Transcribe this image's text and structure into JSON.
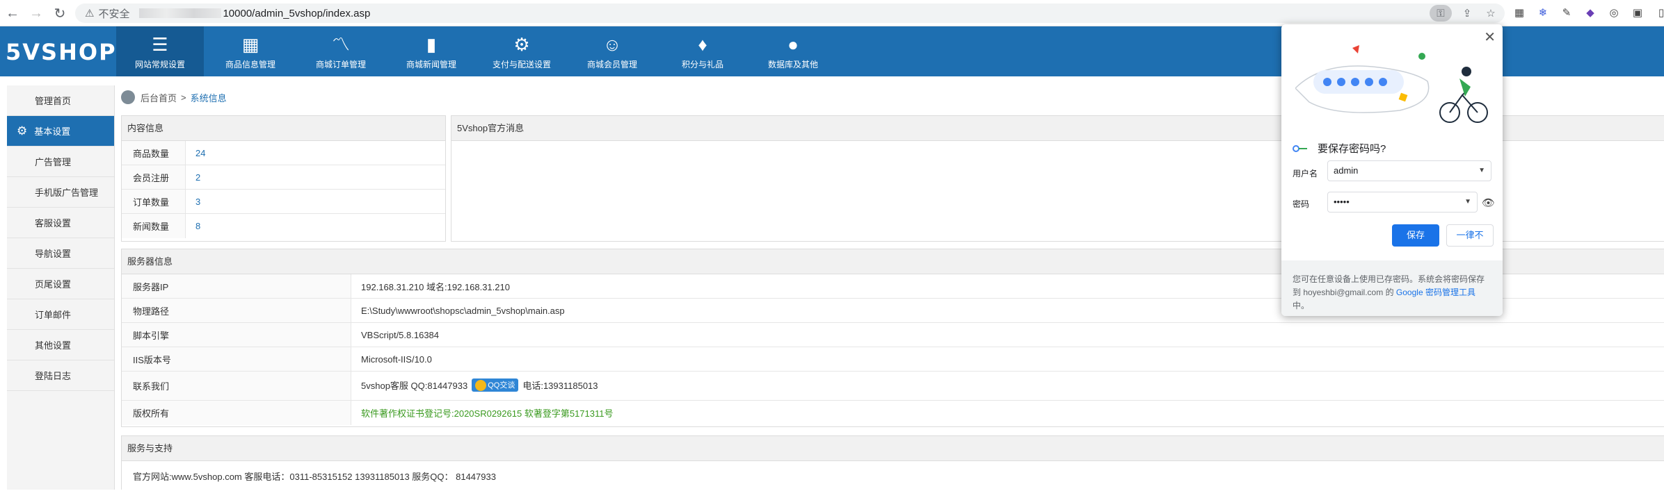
{
  "browser": {
    "insecure_label": "不安全",
    "url_rest": "10000/admin_5vshop/index.asp"
  },
  "app": {
    "logo": "5VSHOP",
    "nav": [
      {
        "label": "网站常规设置",
        "icon": "list-icon"
      },
      {
        "label": "商品信息管理",
        "icon": "calendar-icon"
      },
      {
        "label": "商城订单管理",
        "icon": "chart-icon"
      },
      {
        "label": "商城新闻管理",
        "icon": "bar-chart-icon"
      },
      {
        "label": "支付与配送设置",
        "icon": "gear-icon"
      },
      {
        "label": "商城会员管理",
        "icon": "user-icon"
      },
      {
        "label": "积分与礼品",
        "icon": "shirt-icon"
      },
      {
        "label": "数据库及其他",
        "icon": "chat-icon"
      }
    ]
  },
  "sidebar": {
    "items": [
      {
        "label": "管理首页"
      },
      {
        "label": "基本设置"
      },
      {
        "label": "广告管理"
      },
      {
        "label": "手机版广告管理"
      },
      {
        "label": "客服设置"
      },
      {
        "label": "导航设置"
      },
      {
        "label": "页尾设置"
      },
      {
        "label": "订单邮件"
      },
      {
        "label": "其他设置"
      },
      {
        "label": "登陆日志"
      }
    ]
  },
  "breadcrumb": {
    "home": "后台首页",
    "sep": ">",
    "current": "系统信息"
  },
  "content_info": {
    "title": "内容信息",
    "rows": [
      {
        "label": "商品数量",
        "value": "24"
      },
      {
        "label": "会员注册",
        "value": "2"
      },
      {
        "label": "订单数量",
        "value": "3"
      },
      {
        "label": "新闻数量",
        "value": "8"
      }
    ]
  },
  "official_msg": {
    "title": "5Vshop官方消息"
  },
  "server_info": {
    "title": "服务器信息",
    "rows": [
      {
        "label": "服务器IP",
        "value": "192.168.31.210 域名:192.168.31.210"
      },
      {
        "label": "物理路径",
        "value": "E:\\Study\\wwwroot\\shopsc\\admin_5vshop\\main.asp"
      },
      {
        "label": "脚本引擎",
        "value": "VBScript/5.8.16384"
      },
      {
        "label": "IIS版本号",
        "value": "Microsoft-IIS/10.0"
      }
    ],
    "contact_label": "联系我们",
    "contact_prefix": "5vshop客服 QQ:81447933",
    "qq_button": "QQ交谈",
    "contact_phone": "电话:13931185013",
    "copyright_label": "版权所有",
    "copyright_value": "软件著作权证书登记号:2020SR0292615 软著登字第5171311号"
  },
  "support": {
    "title": "服务与支持",
    "text": "官方网站:www.5vshop.com 客服电话：0311-85315152 13931185013 服务QQ：   81447933"
  },
  "password_popup": {
    "title": "要保存密码吗?",
    "username_label": "用户名",
    "username_value": "admin",
    "password_label": "密码",
    "password_value": "•••••",
    "save_label": "保存",
    "never_label": "一律不",
    "footer_text": "您可在任意设备上使用已存密码。系统会将密码保存到 hoyeshbi@gmail.com 的",
    "footer_link": "Google 密码管理工具",
    "footer_suffix": "中。",
    "colors": {
      "primary": "#1a73e8"
    }
  }
}
